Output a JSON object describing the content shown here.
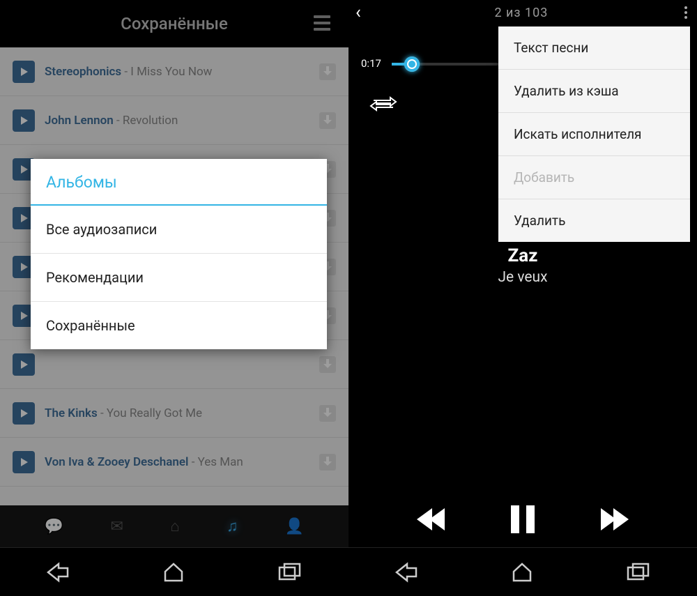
{
  "left": {
    "header_title": "Сохранённые",
    "tracks": [
      {
        "artist": "Stereophonics",
        "title": "I Miss You Now"
      },
      {
        "artist": "John Lennon",
        "title": "Revolution"
      },
      {
        "artist": "",
        "title": ""
      },
      {
        "artist": "",
        "title": ""
      },
      {
        "artist": "",
        "title": ""
      },
      {
        "artist": "",
        "title": ""
      },
      {
        "artist": "",
        "title": ""
      },
      {
        "artist": "The Kinks",
        "title": "You Really Got Me"
      },
      {
        "artist": "Von Iva &  Zooey Deschanel",
        "title": "Yes Man"
      }
    ],
    "popup": {
      "title": "Альбомы",
      "items": [
        "Все аудиозаписи",
        "Рекомендации",
        "Сохранённые"
      ]
    }
  },
  "right": {
    "counter": "2 из 103",
    "time": "0:17",
    "artist": "Zaz",
    "title": "Je veux",
    "menu": {
      "items": [
        {
          "label": "Текст песни",
          "disabled": false
        },
        {
          "label": "Удалить из кэша",
          "disabled": false
        },
        {
          "label": "Искать исполнителя",
          "disabled": false
        },
        {
          "label": "Добавить",
          "disabled": true
        },
        {
          "label": "Удалить",
          "disabled": false
        }
      ]
    }
  }
}
